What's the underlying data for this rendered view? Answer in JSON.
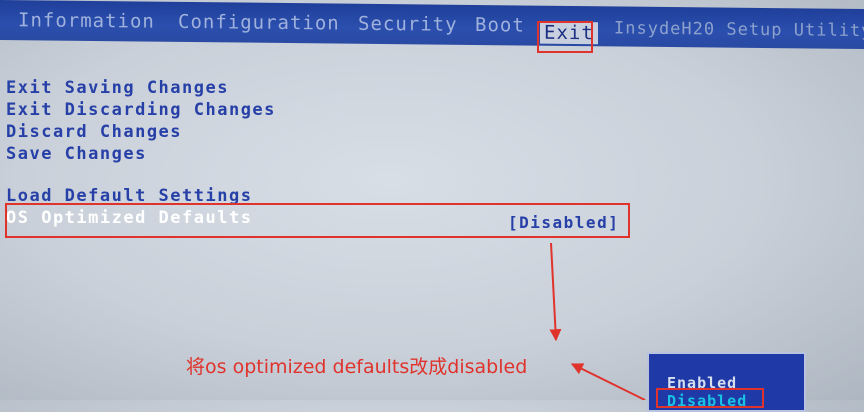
{
  "menu": {
    "items": [
      {
        "label": "Information"
      },
      {
        "label": "Configuration"
      },
      {
        "label": "Security"
      },
      {
        "label": "Boot"
      },
      {
        "label": "Exit"
      }
    ],
    "active": "Exit",
    "vendor": "InsydeH20 Setup Utility"
  },
  "options": [
    {
      "label": "Exit Saving Changes"
    },
    {
      "label": "Exit Discarding Changes"
    },
    {
      "label": "Discard Changes"
    },
    {
      "label": "Save Changes"
    },
    {
      "label": "Load Default Settings"
    },
    {
      "label": "OS Optimized Defaults",
      "value": "[Disabled]"
    }
  ],
  "annotation": "将os optimized defaults改成disabled",
  "popup": {
    "options": [
      {
        "label": "Enabled"
      },
      {
        "label": "Disabled"
      }
    ]
  },
  "colors": {
    "accent_red": "#e0332c",
    "menubar_blue": "#2b4fae",
    "text_blue": "#2740a8"
  }
}
